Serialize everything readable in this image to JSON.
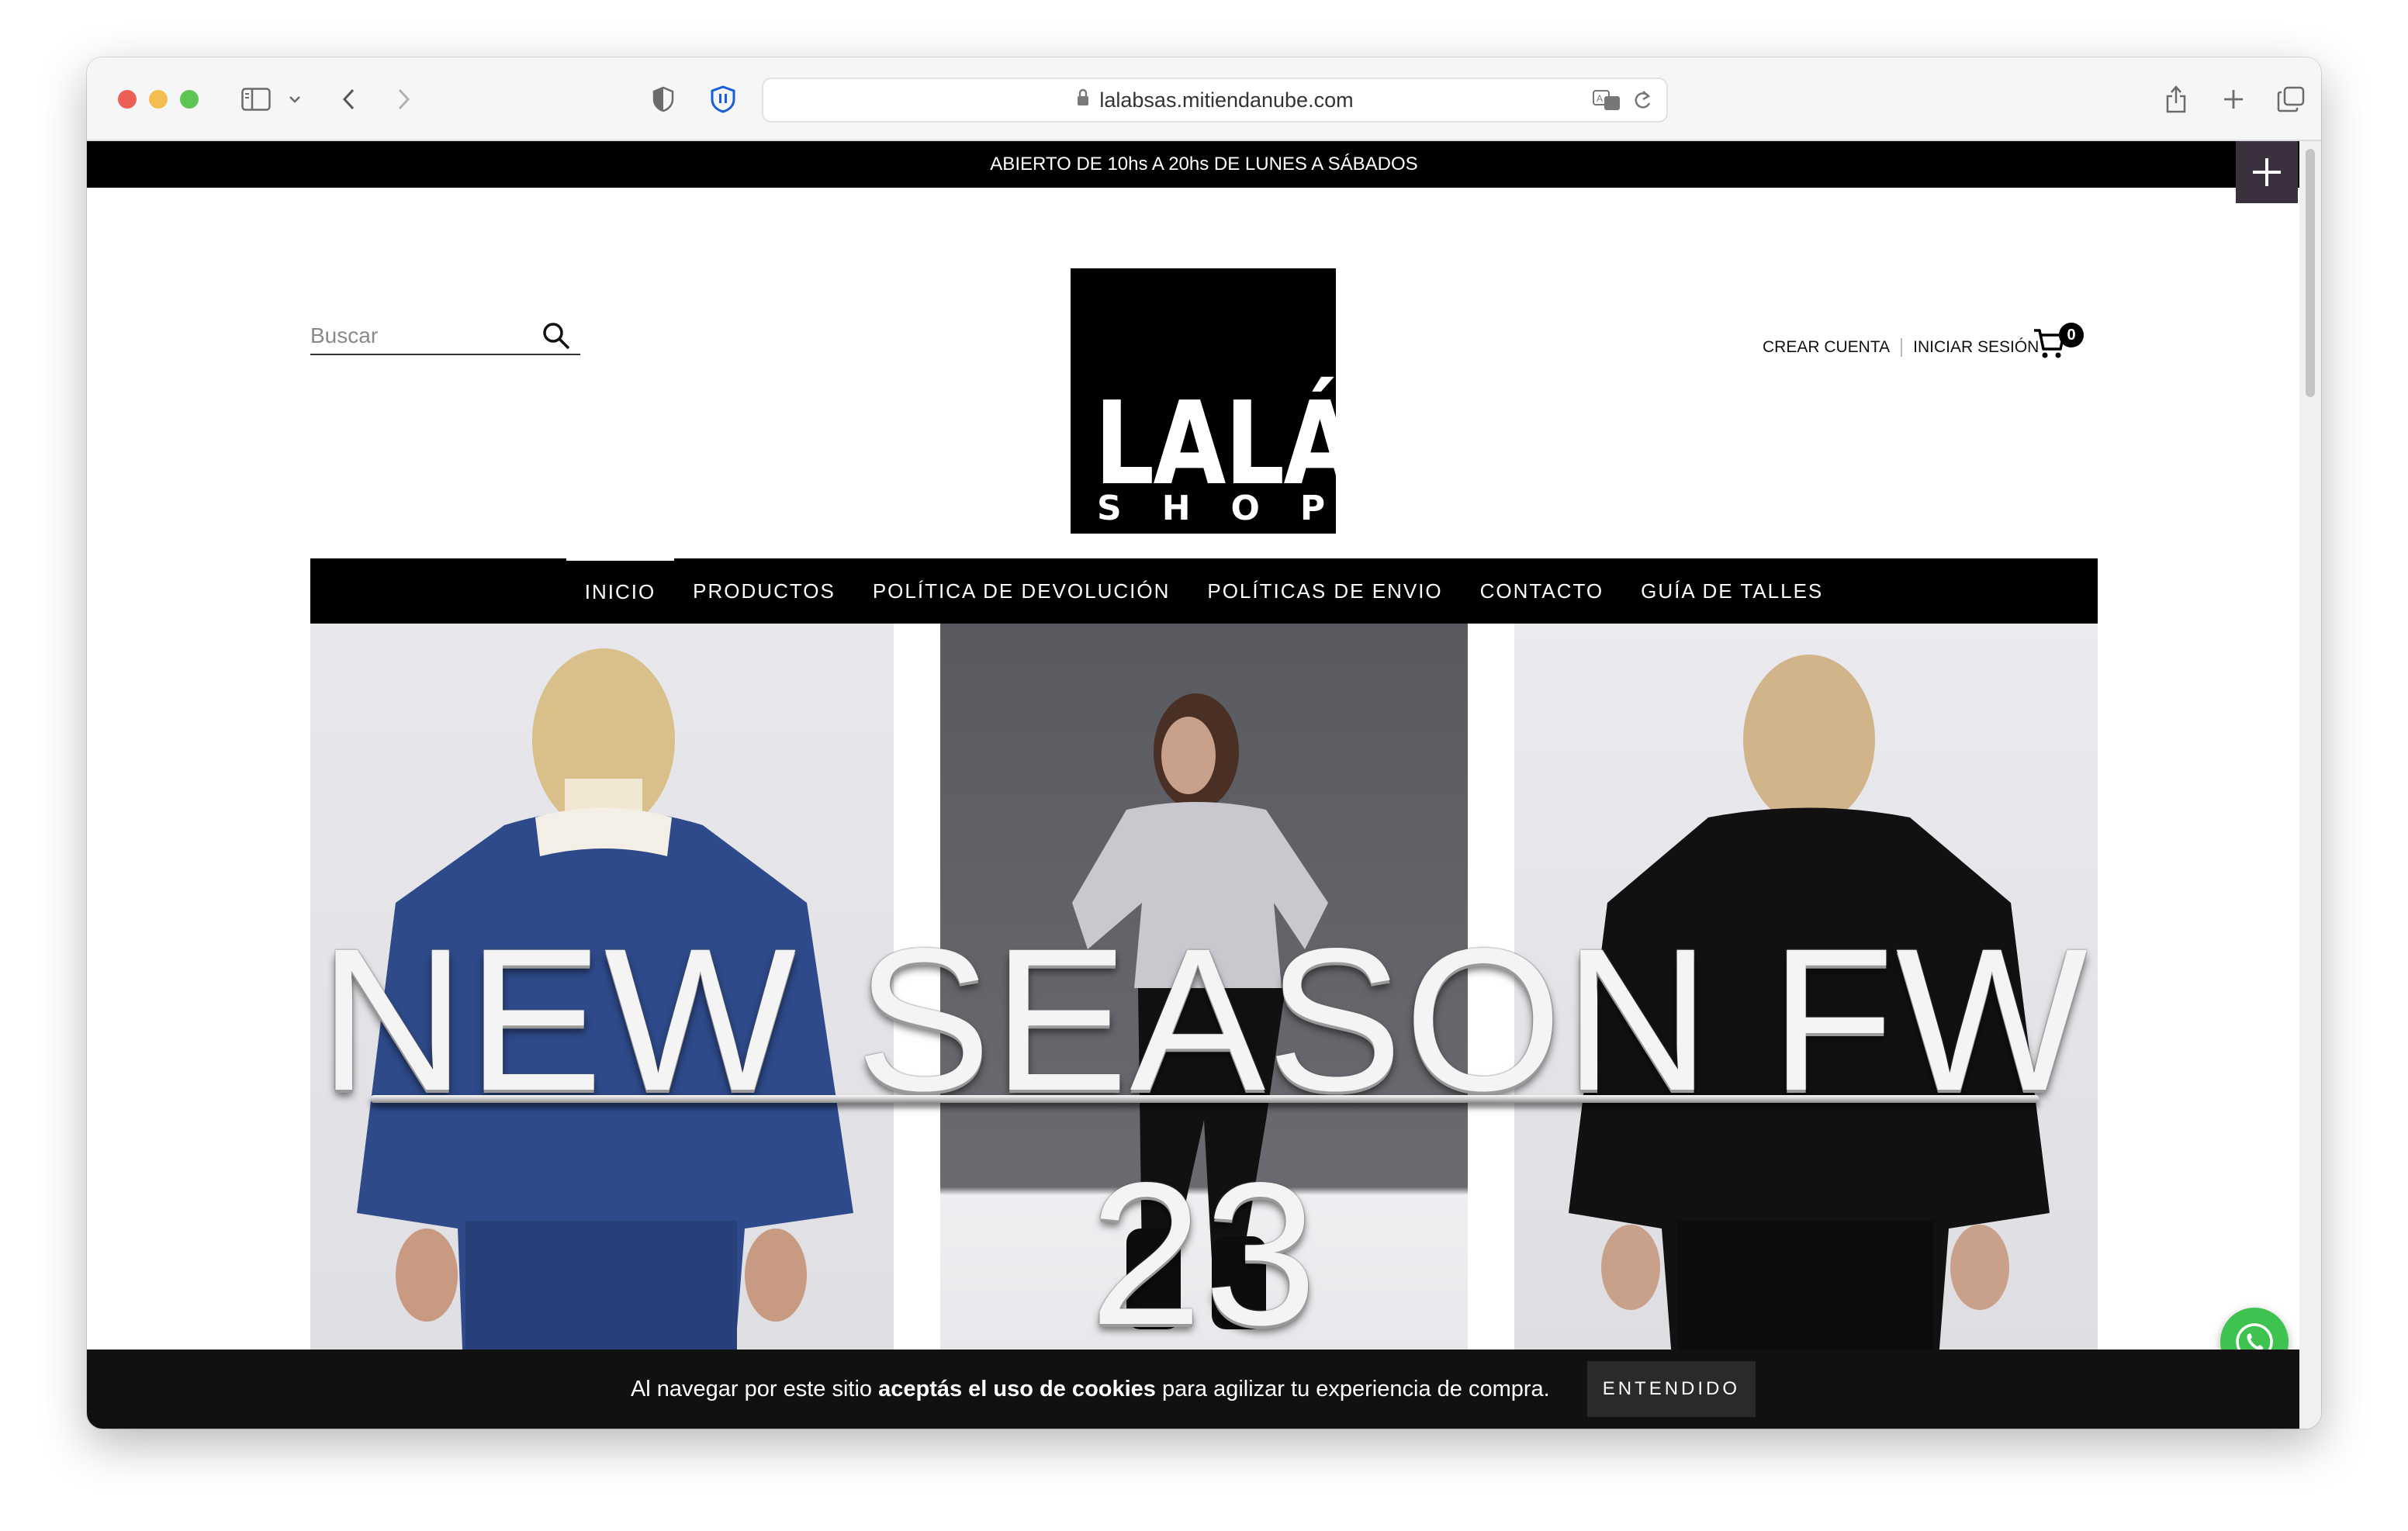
{
  "browser": {
    "url": "lalabsas.mitiendanube.com"
  },
  "store": {
    "announcement": "ABIERTO DE 10hs A 20hs DE LUNES A SÁBADOS",
    "logo_main": "LALÁ",
    "logo_sub": "SHOP",
    "search_placeholder": "Buscar",
    "create_account": "CREAR CUENTA",
    "login": "INICIAR SESIÓN",
    "cart_count": "0"
  },
  "nav": {
    "items": [
      "INICIO",
      "PRODUCTOS",
      "POLÍTICA DE DEVOLUCIÓN",
      "POLÍTICAS DE ENVIO",
      "CONTACTO",
      "GUÍA DE TALLES"
    ],
    "active": "INICIO"
  },
  "hero": {
    "title": "NEW SEASON FW 23",
    "panel_colors": [
      "#2e4a8a",
      "#d8d8dc",
      "#111111"
    ]
  },
  "cookie_banner": {
    "text_before": "Al navegar por este sitio ",
    "text_bold": "aceptás el uso de cookies",
    "text_after": " para agilizar tu experiencia de compra.",
    "button": "ENTENDIDO"
  },
  "colors": {
    "brand_black": "#000000",
    "whatsapp_green": "#3fc350"
  }
}
